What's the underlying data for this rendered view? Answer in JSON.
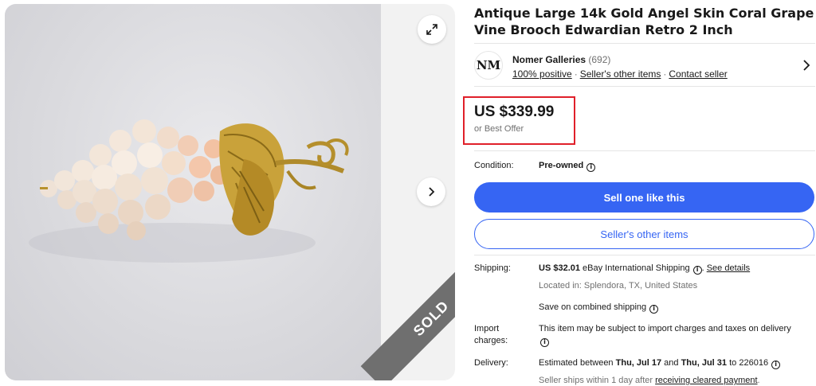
{
  "listing": {
    "title": "Antique Large 14k Gold Angel Skin Coral Grape Vine Brooch Edwardian Retro 2 Inch",
    "sold_badge": "SOLD"
  },
  "gallery": {
    "expand_icon": "expand-icon",
    "next_icon": "chevron-right-icon"
  },
  "seller": {
    "name": "Nomer Galleries",
    "feedback_count": "(692)",
    "positive": "100% positive",
    "other_items_link": "Seller's other items",
    "contact_link": "Contact seller",
    "logo_text": "NM"
  },
  "price": {
    "amount": "US $339.99",
    "best_offer": "or Best Offer"
  },
  "condition": {
    "label": "Condition:",
    "value": "Pre-owned"
  },
  "buttons": {
    "sell_one": "Sell one like this",
    "other_items": "Seller's other items"
  },
  "shipping": {
    "label": "Shipping:",
    "cost": "US $32.01",
    "service": "eBay International Shipping",
    "see_details": "See details",
    "location": "Located in: Splendora, TX, United States",
    "combined": "Save on combined shipping"
  },
  "import": {
    "label_line1": "Import",
    "label_line2": "charges:",
    "text": "This item may be subject to import charges and taxes on delivery"
  },
  "delivery": {
    "label": "Delivery:",
    "prefix": "Estimated between",
    "start": "Thu, Jul 17",
    "and": "and",
    "end": "Thu, Jul 31",
    "to": "to",
    "zip": "226016",
    "ships_prefix": "Seller ships within 1 day after",
    "ships_link": "receiving cleared payment",
    "ships_suffix": "."
  },
  "colors": {
    "accent": "#3665f3",
    "highlight_box": "#e0202a",
    "text": "#191919",
    "muted": "#707070"
  }
}
